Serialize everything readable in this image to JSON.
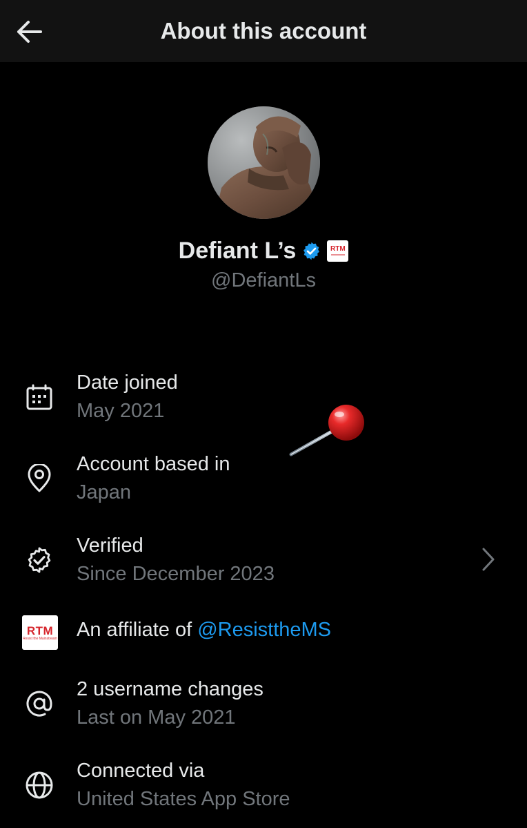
{
  "header": {
    "title": "About this account",
    "back_icon": "arrow-left-icon"
  },
  "profile": {
    "name": "Defiant L’s",
    "handle": "@DefiantLs",
    "verified_badge": "verified-check-icon",
    "affiliate_badge_text": "RTM"
  },
  "rows": {
    "date_joined": {
      "label": "Date joined",
      "value": "May 2021",
      "icon": "calendar-icon"
    },
    "account_based": {
      "label": "Account based in",
      "value": "Japan",
      "icon": "location-pin-icon"
    },
    "verified": {
      "label": "Verified",
      "value": "Since December 2023",
      "icon": "verified-outline-icon"
    },
    "affiliate": {
      "label_prefix": "An affiliate of ",
      "link": "@ResisttheMS",
      "badge_text": "RTM",
      "badge_subtext": "Resist the Mainstream"
    },
    "username_changes": {
      "label": "2 username changes",
      "value": "Last on May 2021",
      "icon": "at-sign-icon"
    },
    "connected": {
      "label": "Connected via",
      "value": "United States App Store",
      "icon": "globe-icon"
    }
  },
  "colors": {
    "background": "#000000",
    "header_background": "#121212",
    "primary_text": "#e7e9ea",
    "secondary_text": "#71767b",
    "link": "#1d9bf0",
    "verified_blue": "#1d9bf0",
    "rtm_red": "#d6242b"
  }
}
